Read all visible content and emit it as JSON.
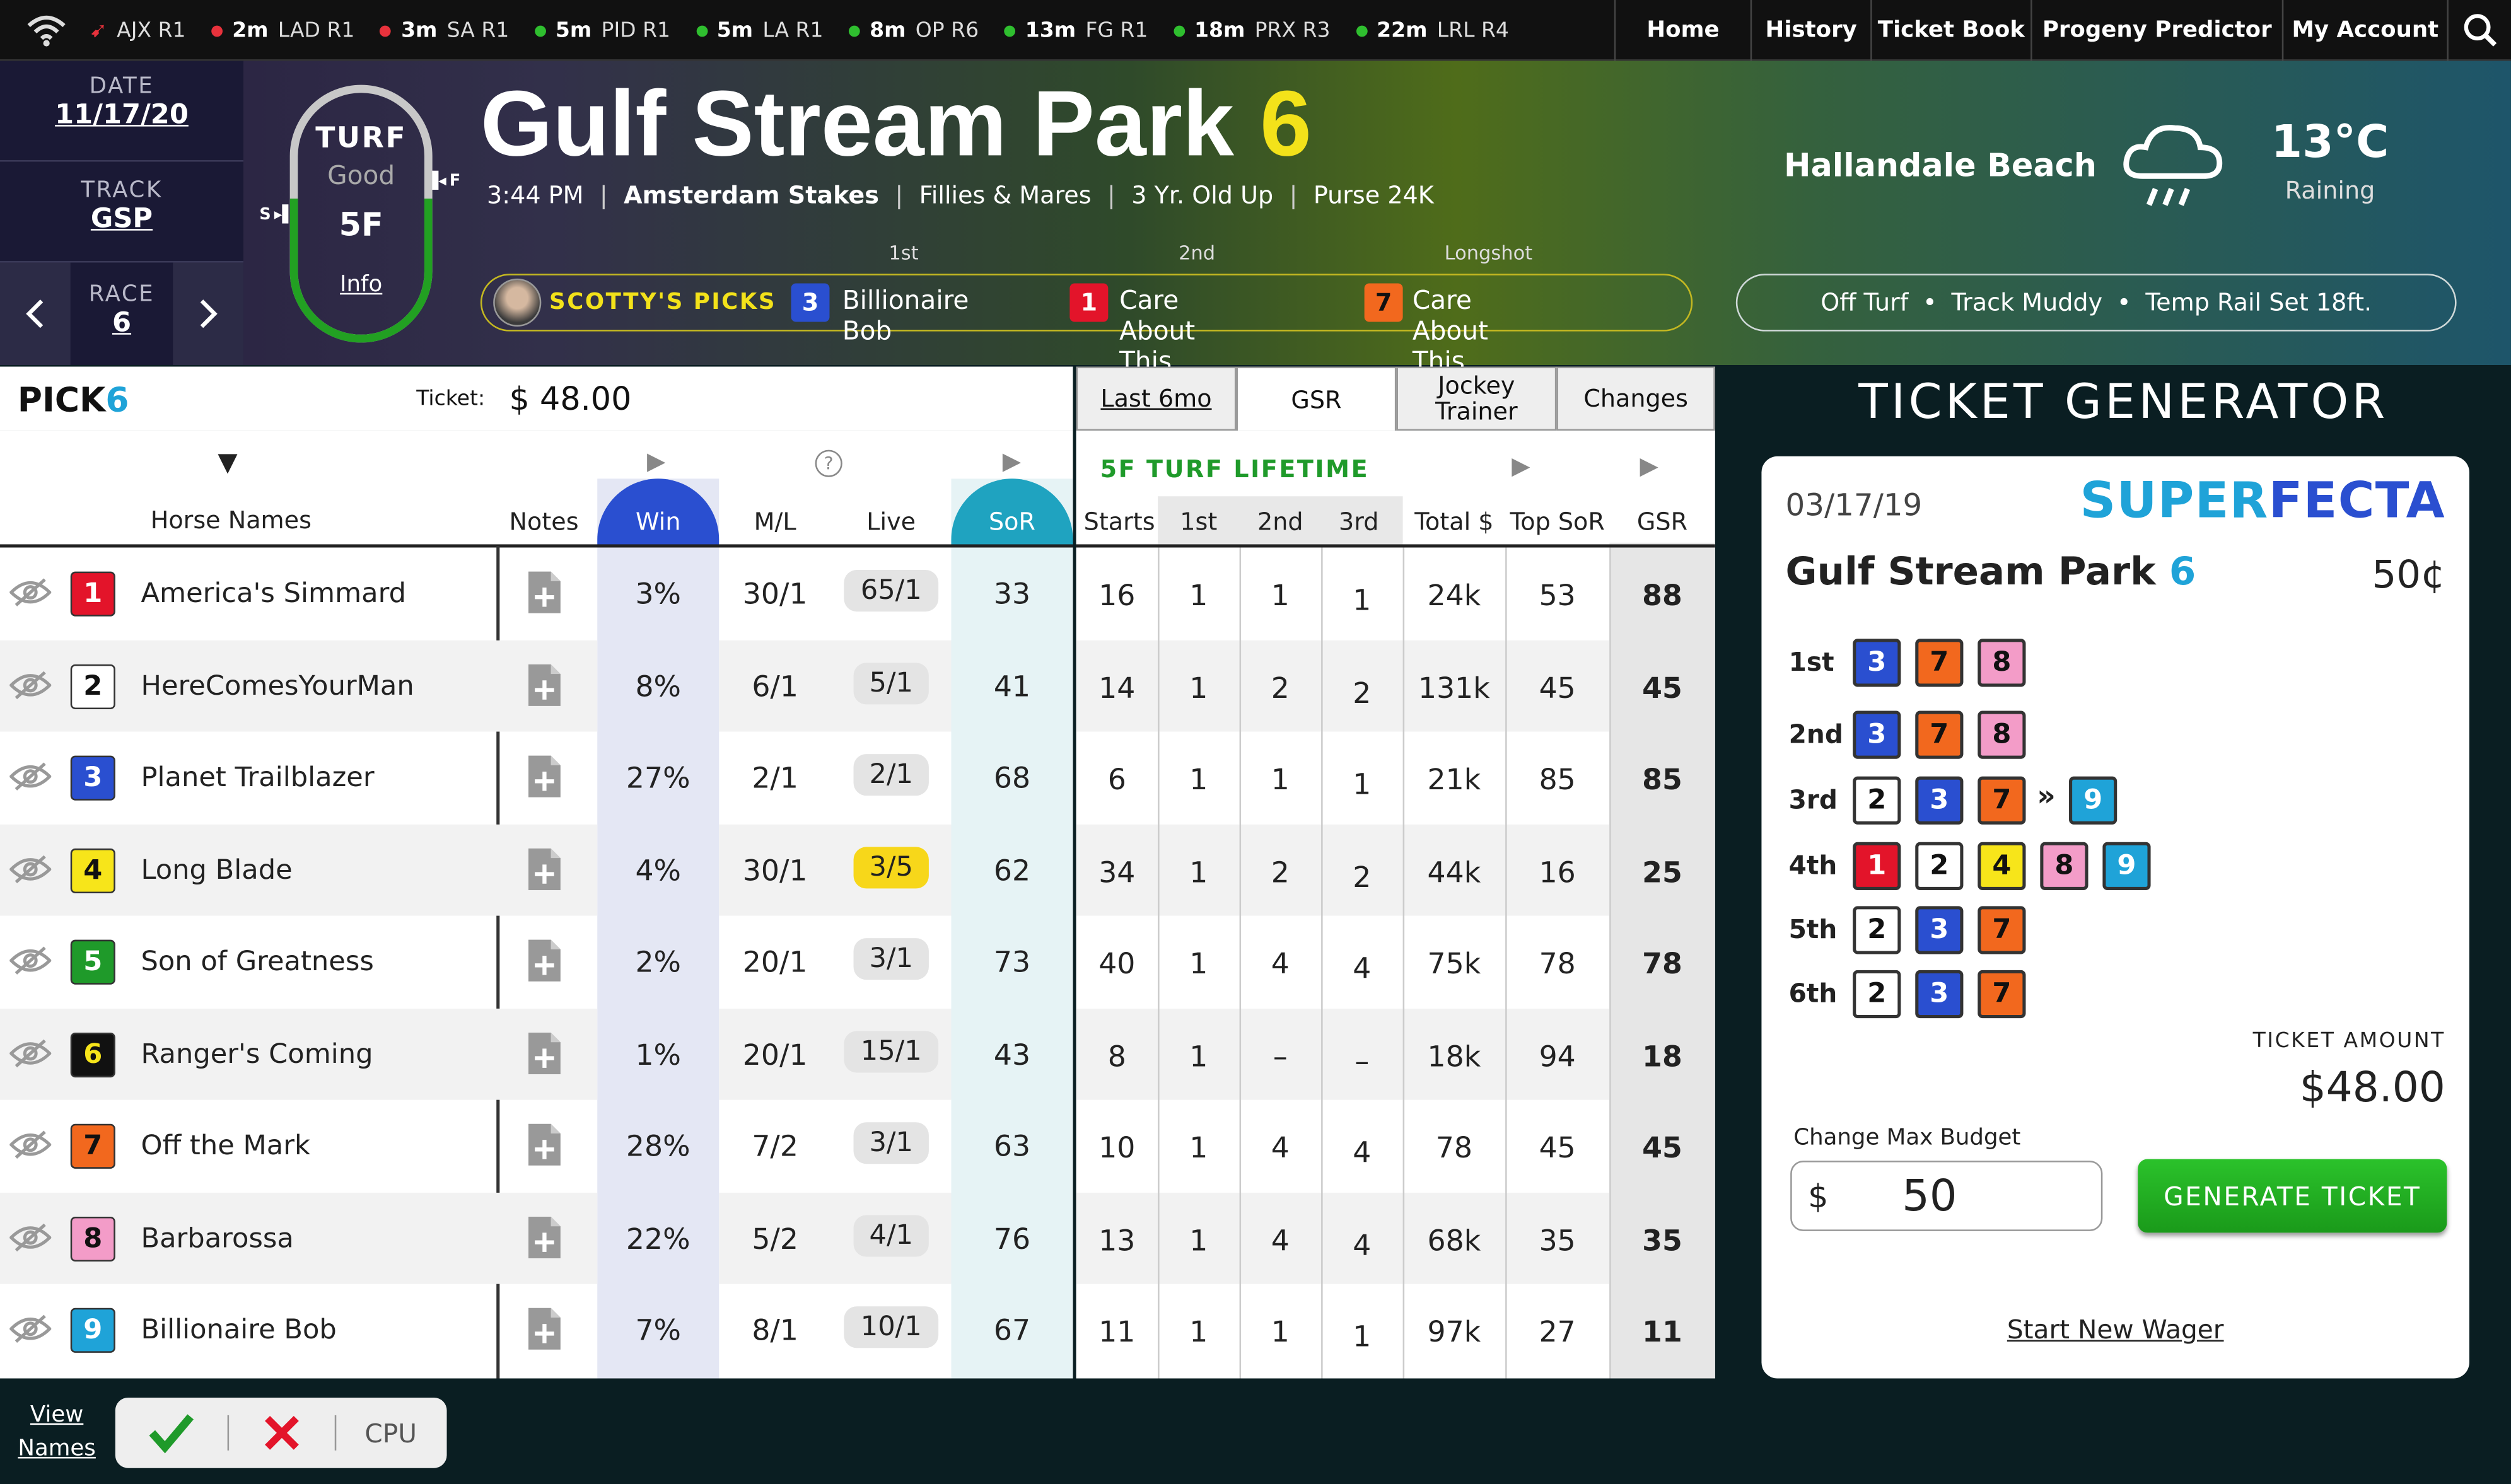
{
  "topbar": {
    "alerts": [
      {
        "time": "",
        "label": "AJX R1",
        "dot": "rocket"
      },
      {
        "time": "2m",
        "label": "LAD R1",
        "dot": "#e8323c"
      },
      {
        "time": "3m",
        "label": "SA R1",
        "dot": "#e8323c"
      },
      {
        "time": "5m",
        "label": "PID R1",
        "dot": "#2fbf2f"
      },
      {
        "time": "5m",
        "label": "LA R1",
        "dot": "#2fbf2f"
      },
      {
        "time": "8m",
        "label": "OP R6",
        "dot": "#2fbf2f"
      },
      {
        "time": "13m",
        "label": "FG R1",
        "dot": "#2fbf2f"
      },
      {
        "time": "18m",
        "label": "PRX R3",
        "dot": "#2fbf2f"
      },
      {
        "time": "22m",
        "label": "LRL R4",
        "dot": "#2fbf2f"
      }
    ],
    "nav": [
      "Home",
      "History",
      "Ticket Book",
      "Progeny Predictor",
      "My Account"
    ]
  },
  "left": {
    "date_label": "DATE",
    "date": "11/17/20",
    "track_label": "TRACK",
    "track": "GSP",
    "race_label": "RACE",
    "race": "6"
  },
  "oval": {
    "surface": "TURF",
    "condition": "Good",
    "distance": "5F",
    "info": "Info",
    "start": "S",
    "finish": "F"
  },
  "race": {
    "title": "Gulf Stream Park",
    "number": "6",
    "details": [
      "3:44 PM",
      "Amsterdam Stakes",
      "Fillies & Mares",
      "3 Yr. Old Up",
      "Purse 24K"
    ],
    "picks_label": "SCOTTY'S PICKS",
    "picks": [
      {
        "rank": "1st",
        "num": "3",
        "name": "Billionaire Bob",
        "color": "#2a4fd0",
        "text": "#fff"
      },
      {
        "rank": "2nd",
        "num": "1",
        "name": "Care About This",
        "color": "#e3142a",
        "text": "#fff"
      },
      {
        "rank": "Longshot",
        "num": "7",
        "name": "Care About This",
        "color": "#f2681e",
        "text": "#111"
      }
    ]
  },
  "weather": {
    "city": "Hallandale Beach",
    "temp": "13°C",
    "condition": "Raining",
    "icon": "rain-cloud-icon",
    "track_notes": [
      "Off Turf",
      "Track Muddy",
      "Temp Rail Set 18ft."
    ]
  },
  "pick6": {
    "label": "PICK",
    "label_num": "6",
    "ticket_label": "Ticket:",
    "ticket_value": "$ 48.00"
  },
  "columns": {
    "horse": "Horse Names",
    "notes": "Notes",
    "win": "Win",
    "ml": "M/L",
    "live": "Live",
    "sor": "SoR"
  },
  "tabs": [
    "Last 6mo",
    "GSR",
    "Jockey Trainer",
    "Changes"
  ],
  "lifetime_label": "5F TURF LIFETIME",
  "stats_cols": [
    "Starts",
    "1st",
    "2nd",
    "3rd",
    "Total $",
    "Top SoR",
    "GSR"
  ],
  "horses": [
    {
      "num": "1",
      "name": "America's Simmard",
      "win": "3%",
      "ml": "30/1",
      "live": "65/1",
      "sor": "33",
      "starts": "16",
      "first": "1",
      "second": "1",
      "third": "1",
      "total": "24k",
      "top": "53",
      "gsr": "88",
      "bg": "#e3142a",
      "fg": "#fff",
      "hl": false
    },
    {
      "num": "2",
      "name": "HereComesYourMan",
      "win": "8%",
      "ml": "6/1",
      "live": "5/1",
      "sor": "41",
      "starts": "14",
      "first": "1",
      "second": "2",
      "third": "2",
      "total": "131k",
      "top": "45",
      "gsr": "45",
      "bg": "#fff",
      "fg": "#111",
      "hl": false
    },
    {
      "num": "3",
      "name": "Planet Trailblazer",
      "win": "27%",
      "ml": "2/1",
      "live": "2/1",
      "sor": "68",
      "starts": "6",
      "first": "1",
      "second": "1",
      "third": "1",
      "total": "21k",
      "top": "85",
      "gsr": "85",
      "bg": "#2a4fd0",
      "fg": "#fff",
      "hl": false
    },
    {
      "num": "4",
      "name": "Long Blade",
      "win": "4%",
      "ml": "30/1",
      "live": "3/5",
      "sor": "62",
      "starts": "34",
      "first": "1",
      "second": "2",
      "third": "2",
      "total": "44k",
      "top": "16",
      "gsr": "25",
      "bg": "#f7e51a",
      "fg": "#111",
      "hl": true
    },
    {
      "num": "5",
      "name": "Son of Greatness",
      "win": "2%",
      "ml": "20/1",
      "live": "3/1",
      "sor": "73",
      "starts": "40",
      "first": "1",
      "second": "4",
      "third": "4",
      "total": "75k",
      "top": "78",
      "gsr": "78",
      "bg": "#1f9a2a",
      "fg": "#fff",
      "hl": false
    },
    {
      "num": "6",
      "name": "Ranger's Coming",
      "win": "1%",
      "ml": "20/1",
      "live": "15/1",
      "sor": "43",
      "starts": "8",
      "first": "1",
      "second": "–",
      "third": "–",
      "total": "18k",
      "top": "94",
      "gsr": "18",
      "bg": "#111",
      "fg": "#f7e51a",
      "hl": false
    },
    {
      "num": "7",
      "name": "Off the Mark",
      "win": "28%",
      "ml": "7/2",
      "live": "3/1",
      "sor": "63",
      "starts": "10",
      "first": "1",
      "second": "4",
      "third": "4",
      "total": "78",
      "top": "45",
      "gsr": "45",
      "bg": "#f2681e",
      "fg": "#111",
      "hl": false
    },
    {
      "num": "8",
      "name": "Barbarossa",
      "win": "22%",
      "ml": "5/2",
      "live": "4/1",
      "sor": "76",
      "starts": "13",
      "first": "1",
      "second": "4",
      "third": "4",
      "total": "68k",
      "top": "35",
      "gsr": "35",
      "bg": "#f39cc8",
      "fg": "#111",
      "hl": false
    },
    {
      "num": "9",
      "name": "Billionaire Bob",
      "win": "7%",
      "ml": "8/1",
      "live": "10/1",
      "sor": "67",
      "starts": "11",
      "first": "1",
      "second": "1",
      "third": "1",
      "total": "97k",
      "top": "27",
      "gsr": "11",
      "bg": "#1fa3d8",
      "fg": "#fff",
      "hl": false
    }
  ],
  "generator": {
    "title": "TICKET GENERATOR",
    "date": "03/17/19",
    "bet_a": "SUPER",
    "bet_b": "FECTA",
    "track": "Gulf Stream Park",
    "race": "6",
    "unit": "50¢",
    "legs": [
      {
        "label": "1st",
        "nums": [
          "3",
          "7",
          "8"
        ],
        "extra": []
      },
      {
        "label": "2nd",
        "nums": [
          "3",
          "7",
          "8"
        ],
        "extra": []
      },
      {
        "label": "3rd",
        "nums": [
          "2",
          "3",
          "7"
        ],
        "extra": [
          "9"
        ]
      },
      {
        "label": "4th",
        "nums": [
          "1",
          "2",
          "4",
          "8",
          "9"
        ],
        "extra": []
      },
      {
        "label": "5th",
        "nums": [
          "2",
          "3",
          "7"
        ],
        "extra": []
      },
      {
        "label": "6th",
        "nums": [
          "2",
          "3",
          "7"
        ],
        "extra": []
      }
    ],
    "amount_label": "TICKET AMOUNT",
    "amount": "$48.00",
    "budget_label": "Change Max Budget",
    "budget_symbol": "$",
    "budget_value": "50",
    "generate": "GENERATE TICKET",
    "new_wager": "Start New Wager"
  },
  "bottom": {
    "view_names_1": "View",
    "view_names_2": "Names",
    "cpu": "CPU"
  },
  "colors": {
    "accent": "#f3e21a",
    "blue": "#1fa3d8",
    "green": "#1f9a2a",
    "win_col": "#e4e7f4",
    "sor_col": "#e6f3f5"
  }
}
